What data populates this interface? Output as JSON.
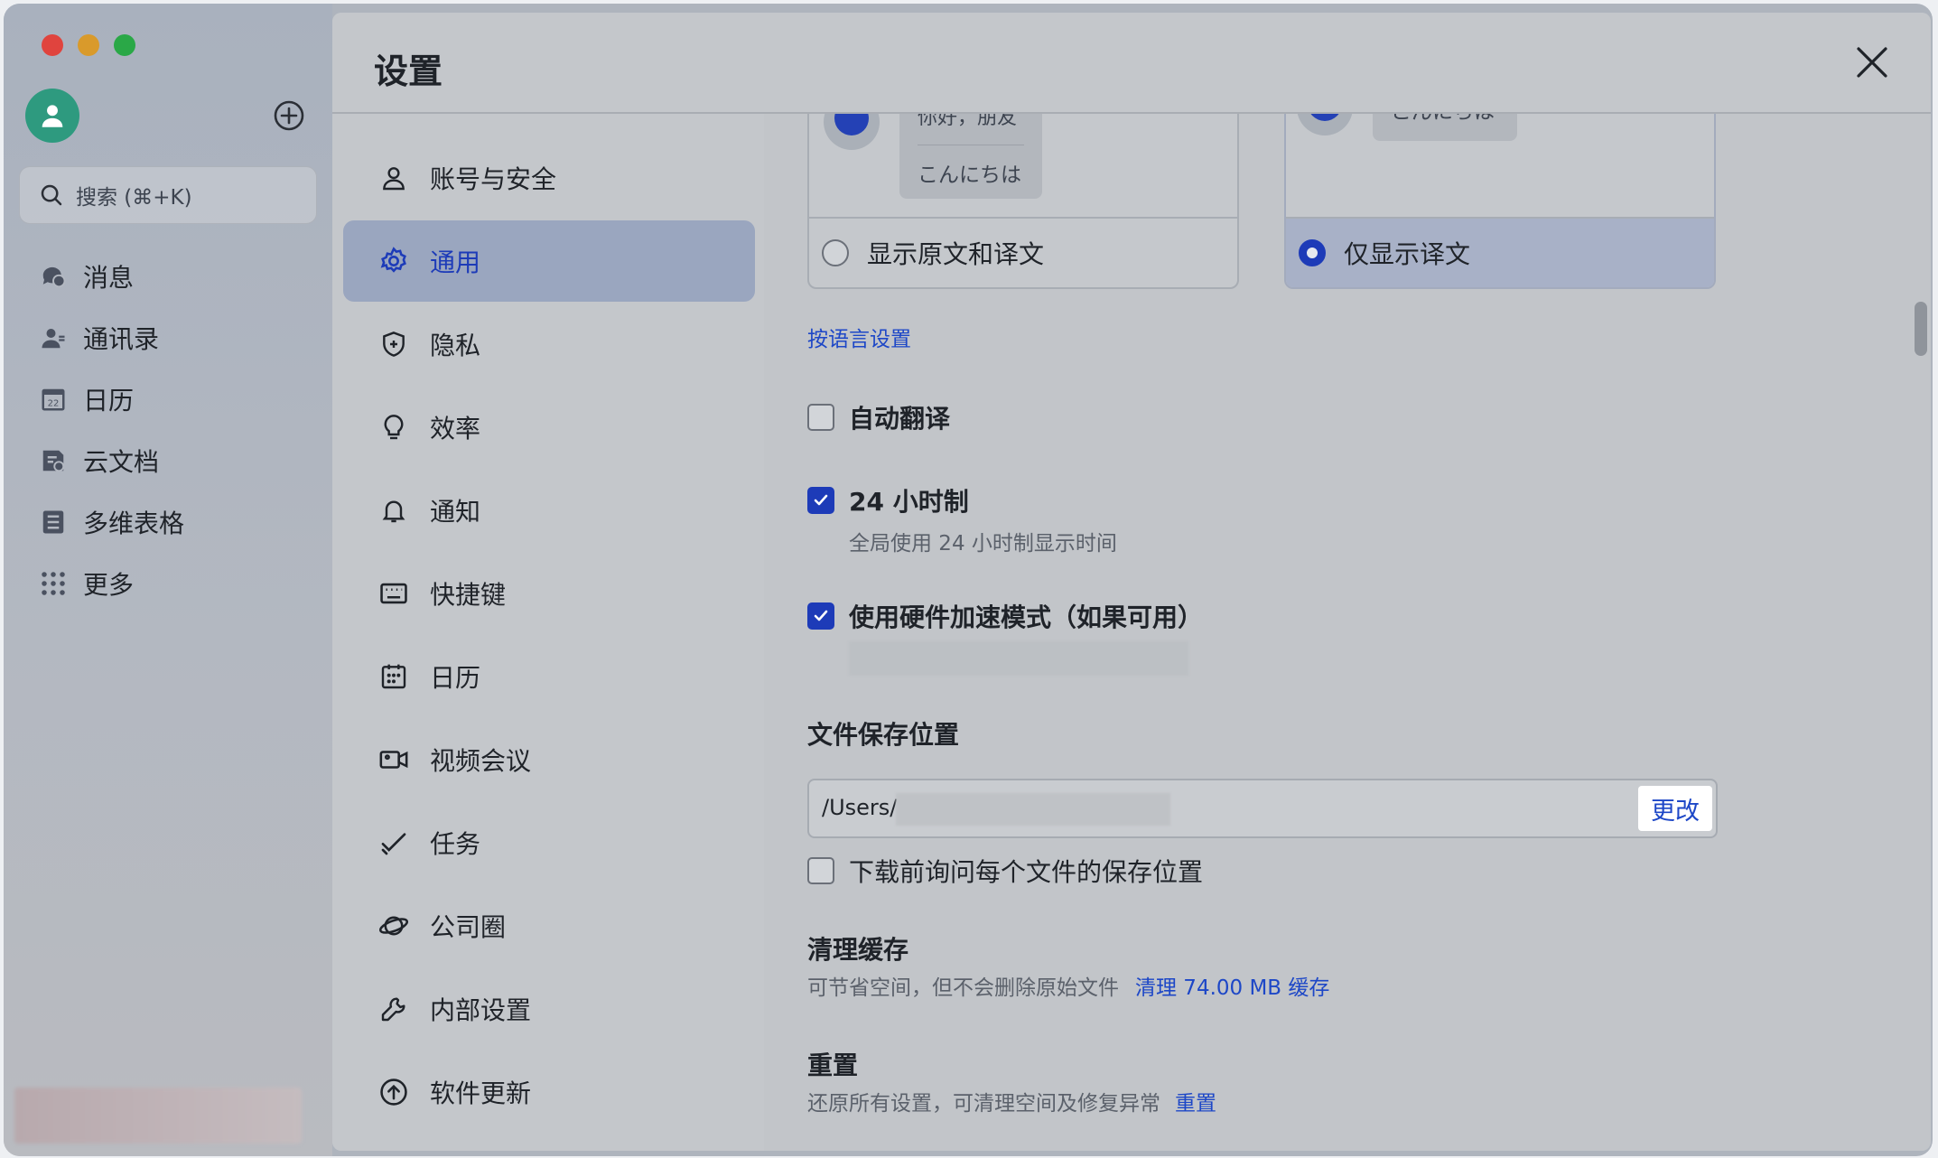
{
  "window_controls": [
    "close",
    "minimize",
    "maximize"
  ],
  "app_sidebar": {
    "search_placeholder": "搜索 (⌘+K)",
    "items": [
      {
        "label": "消息",
        "icon": "chat-icon"
      },
      {
        "label": "通讯录",
        "icon": "contacts-icon"
      },
      {
        "label": "日历",
        "icon": "calendar-icon"
      },
      {
        "label": "云文档",
        "icon": "docs-icon"
      },
      {
        "label": "多维表格",
        "icon": "base-icon"
      },
      {
        "label": "更多",
        "icon": "grid-dots-icon"
      }
    ]
  },
  "settings": {
    "title": "设置",
    "nav": [
      {
        "label": "账号与安全",
        "icon": "person-icon"
      },
      {
        "label": "通用",
        "icon": "gear-icon",
        "active": true
      },
      {
        "label": "隐私",
        "icon": "shield-icon"
      },
      {
        "label": "效率",
        "icon": "lightbulb-icon"
      },
      {
        "label": "通知",
        "icon": "bell-icon"
      },
      {
        "label": "快捷键",
        "icon": "keyboard-icon"
      },
      {
        "label": "日历",
        "icon": "calendar-icon"
      },
      {
        "label": "视频会议",
        "icon": "video-icon"
      },
      {
        "label": "任务",
        "icon": "task-check-icon"
      },
      {
        "label": "公司圈",
        "icon": "planet-icon"
      },
      {
        "label": "内部设置",
        "icon": "wrench-icon"
      },
      {
        "label": "软件更新",
        "icon": "upload-icon"
      }
    ]
  },
  "translation": {
    "card_a": {
      "bubble_line1": "你好，朋友",
      "bubble_line2": "こんにちは",
      "option": "显示原文和译文",
      "selected": false
    },
    "card_b": {
      "bubble_line1": "こんにちは",
      "option": "仅显示译文",
      "selected": true
    },
    "by_language_link": "按语言设置"
  },
  "options": {
    "auto_translate": {
      "label": "自动翻译",
      "checked": false
    },
    "clock_24h": {
      "label": "24 小时制",
      "desc": "全局使用 24 小时制显示时间",
      "checked": true
    },
    "hw_accel": {
      "label": "使用硬件加速模式（如果可用）",
      "checked": true
    }
  },
  "file_location": {
    "title": "文件保存位置",
    "path": "/Users/",
    "change_label": "更改",
    "ask_each": {
      "label": "下载前询问每个文件的保存位置",
      "checked": false
    }
  },
  "cache": {
    "title": "清理缓存",
    "desc": "可节省空间，但不会删除原始文件",
    "action": "清理 74.00 MB 缓存"
  },
  "reset": {
    "title": "重置",
    "desc": "还原所有设置，可清理空间及修复异常",
    "action": "重置"
  },
  "colors": {
    "accent": "#1d3bb8",
    "link": "#1d47c7",
    "active_nav_bg": "#9aa6bf"
  }
}
